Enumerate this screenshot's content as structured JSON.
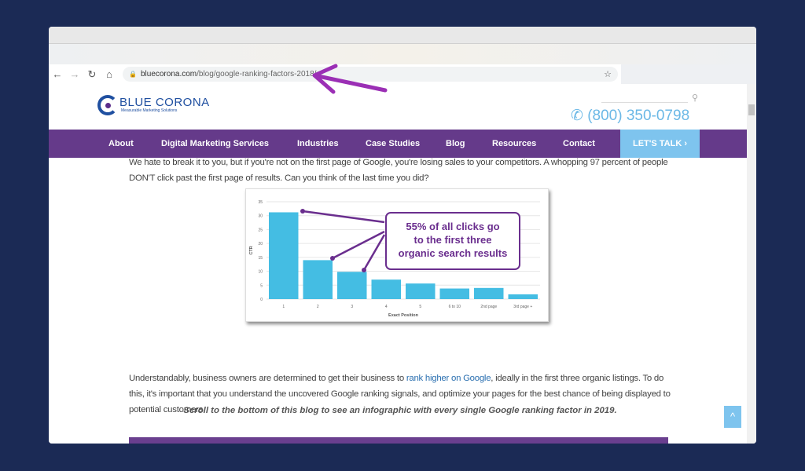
{
  "browser": {
    "url_host": "bluecorona.com",
    "url_path": "/blog/google-ranking-factors-2018/",
    "icons": [
      "back-icon",
      "forward-icon",
      "reload-icon",
      "home-icon",
      "lock-icon",
      "star-icon"
    ]
  },
  "header": {
    "logo_text": "BLUE CORONA",
    "logo_tagline": "Measurable Marketing Solutions",
    "phone": "(800) 350-0798"
  },
  "nav": {
    "items": [
      "About",
      "Digital Marketing Services",
      "Industries",
      "Case Studies",
      "Blog",
      "Resources",
      "Contact"
    ],
    "cta": "LET'S TALK ›"
  },
  "content": {
    "p1": "We hate to break it to you, but if you're not on the first page of Google, you're losing sales to your competitors. A whopping 97 percent of people DON'T click past the first page of results. Can you think of the last time you did?",
    "p2_before": "Understandably, business owners are determined to get their business to ",
    "p2_link": "rank higher on Google",
    "p2_after": ", ideally in the first three organic listings. To do this, it's important that you understand the uncovered Google ranking signals, and optimize your pages for the best chance of being displayed to potential customers.",
    "italic": "Scroll to the bottom of this blog to see an infographic with every single Google ranking factor in 2019.",
    "back_to_top": "^"
  },
  "colors": {
    "nav": "#653a8a",
    "accent": "#7ec4ee",
    "bar": "#44bde3",
    "annotation": "#6a2e8e"
  },
  "chart_data": {
    "type": "bar",
    "categories": [
      "1",
      "2",
      "3",
      "4",
      "5",
      "6 to 10",
      "2nd page",
      "3rd page +"
    ],
    "values": [
      31.2,
      14,
      9.8,
      7,
      5.6,
      3.8,
      4,
      1.7
    ],
    "xlabel": "Exact Position",
    "ylabel": "CTR",
    "ylim": [
      0,
      35
    ],
    "yticks": [
      0,
      5,
      10,
      15,
      20,
      25,
      30,
      35
    ],
    "grid": true,
    "annotation": "55% of all clicks go to the first three organic search results"
  }
}
